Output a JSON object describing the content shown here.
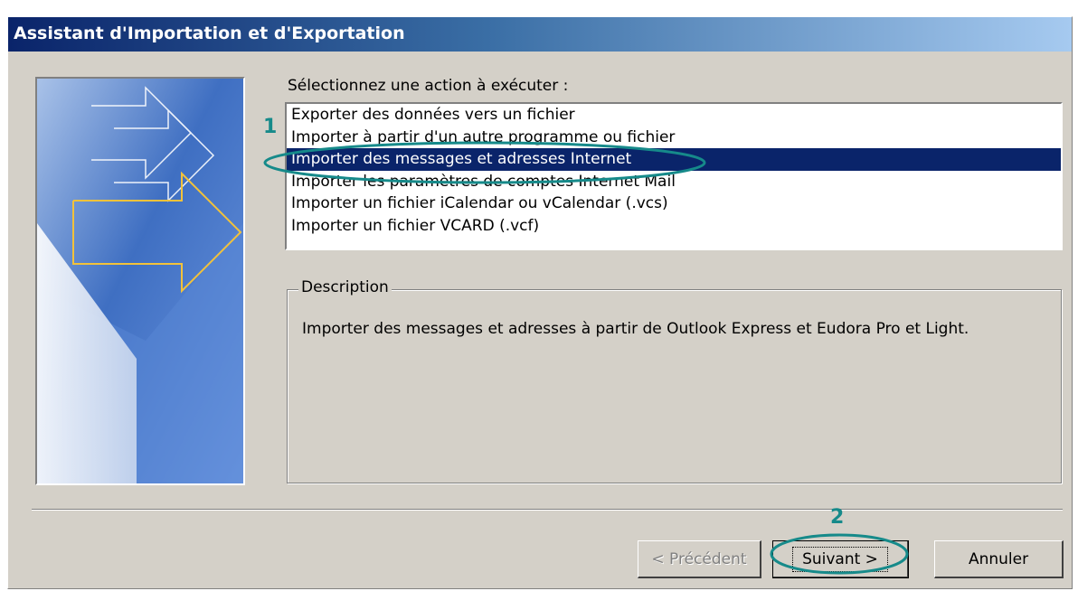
{
  "window": {
    "title": "Assistant d'Importation et d'Exportation"
  },
  "prompt": "Sélectionnez une action à exécuter :",
  "actions": {
    "items": [
      {
        "label": "Exporter des données vers un fichier",
        "selected": false
      },
      {
        "label": "Importer à partir d'un autre programme ou fichier",
        "selected": false
      },
      {
        "label": "Importer des messages et adresses Internet",
        "selected": true
      },
      {
        "label": "Importer les paramètres de comptes Internet Mail",
        "selected": false
      },
      {
        "label": "Importer un fichier iCalendar ou vCalendar (.vcs)",
        "selected": false
      },
      {
        "label": "Importer un fichier VCARD (.vcf)",
        "selected": false
      }
    ]
  },
  "description": {
    "legend": "Description",
    "text": "Importer des messages et adresses à partir de Outlook Express et Eudora Pro et Light."
  },
  "buttons": {
    "previous": "< Précédent",
    "next": "Suivant >",
    "cancel": "Annuler"
  },
  "annotations": {
    "step1": "1",
    "step2": "2",
    "color": "#168a8a"
  },
  "colors": {
    "selection": "#0a246a",
    "dialog_face": "#d4d0c8"
  }
}
